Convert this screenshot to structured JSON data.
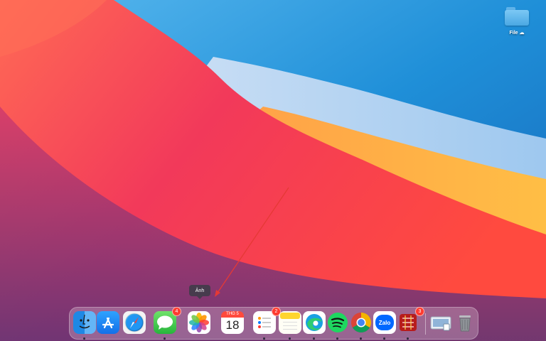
{
  "desktop": {
    "icons": [
      {
        "label": "File",
        "icon": "folder-icon"
      }
    ]
  },
  "tooltip": {
    "text": "Ảnh"
  },
  "dock": {
    "apps": [
      {
        "name": "Finder",
        "icon": "finder-icon",
        "running": true
      },
      {
        "name": "App Store",
        "icon": "app-store-icon",
        "running": false
      },
      {
        "name": "Safari",
        "icon": "safari-icon",
        "running": false
      },
      {
        "name": "Messages",
        "icon": "messages-icon",
        "badge": "4",
        "running": true
      },
      {
        "name": "Photos",
        "icon": "photos-icon",
        "running": false
      },
      {
        "name": "Calendar",
        "icon": "calendar-icon",
        "month": "THG 5",
        "day": "18",
        "running": false
      },
      {
        "name": "Reminders",
        "icon": "reminders-icon",
        "badge": "2",
        "running": true
      },
      {
        "name": "Notes",
        "icon": "notes-icon",
        "running": true
      },
      {
        "name": "Microsoft Edge",
        "icon": "edge-icon",
        "running": true
      },
      {
        "name": "Spotify",
        "icon": "spotify-icon",
        "running": true
      },
      {
        "name": "Google Chrome",
        "icon": "chrome-icon",
        "running": true
      },
      {
        "name": "Zalo",
        "icon": "zalo-icon",
        "label": "Zalo",
        "running": true
      },
      {
        "name": "WinRAR",
        "icon": "winrar-icon",
        "badge": "3",
        "running": true
      },
      {
        "name": "Preview",
        "icon": "preview-icon",
        "running": false
      },
      {
        "name": "Trash",
        "icon": "trash-icon",
        "running": false
      }
    ]
  },
  "colors": {
    "sky": "#1f8fd8",
    "wave_red": "#f03a56",
    "wave_orange": "#ff7a45",
    "wave_yellow": "#ffb040",
    "dock_bg": "rgba(235,210,225,.30)",
    "badge": "#ff3b30",
    "arrow": "#e53935"
  }
}
